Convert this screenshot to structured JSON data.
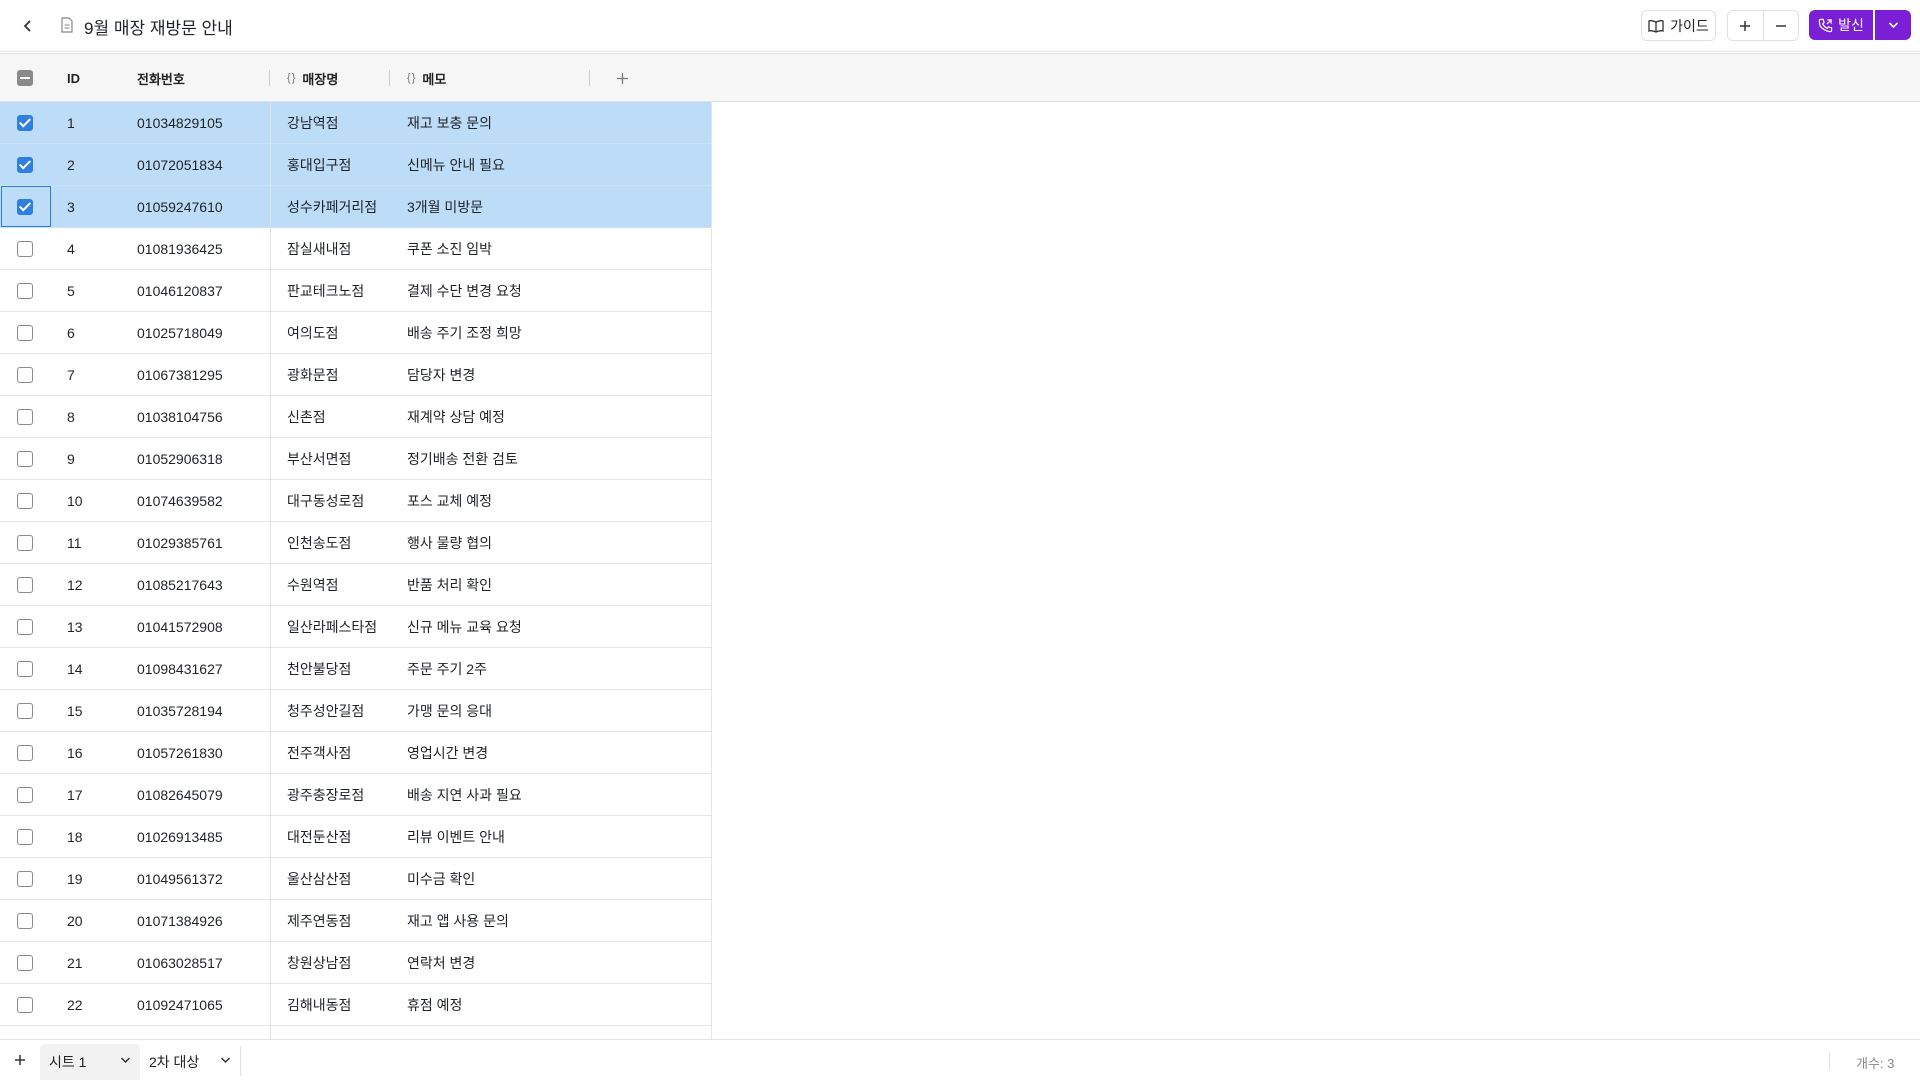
{
  "header": {
    "title": "9월 매장 재방문 안내",
    "guide_label": "가이드",
    "call_label": "발신",
    "accent_color": "#7b1fd6"
  },
  "grid": {
    "columns": [
      {
        "label": "ID"
      },
      {
        "label": "전화번호"
      },
      {
        "label": "매장명",
        "brace": "{ }"
      },
      {
        "label": "메모",
        "brace": "{ }"
      }
    ],
    "selection_color": "#bddcf7",
    "rows": [
      {
        "id": "1",
        "phone": "01034829105",
        "store": "강남역점",
        "memo": "재고 보충 문의",
        "checked": true
      },
      {
        "id": "2",
        "phone": "01072051834",
        "store": "홍대입구점",
        "memo": "신메뉴 안내 필요",
        "checked": true
      },
      {
        "id": "3",
        "phone": "01059247610",
        "store": "성수카페거리점",
        "memo": "3개월 미방문",
        "checked": true,
        "focused": true
      },
      {
        "id": "4",
        "phone": "01081936425",
        "store": "잠실새내점",
        "memo": "쿠폰 소진 임박",
        "checked": false
      },
      {
        "id": "5",
        "phone": "01046120837",
        "store": "판교테크노점",
        "memo": "결제 수단 변경 요청",
        "checked": false
      },
      {
        "id": "6",
        "phone": "01025718049",
        "store": "여의도점",
        "memo": "배송 주기 조정 희망",
        "checked": false
      },
      {
        "id": "7",
        "phone": "01067381295",
        "store": "광화문점",
        "memo": "담당자 변경",
        "checked": false
      },
      {
        "id": "8",
        "phone": "01038104756",
        "store": "신촌점",
        "memo": "재계약 상담 예정",
        "checked": false
      },
      {
        "id": "9",
        "phone": "01052906318",
        "store": "부산서면점",
        "memo": "정기배송 전환 검토",
        "checked": false
      },
      {
        "id": "10",
        "phone": "01074639582",
        "store": "대구동성로점",
        "memo": "포스 교체 예정",
        "checked": false
      },
      {
        "id": "11",
        "phone": "01029385761",
        "store": "인천송도점",
        "memo": "행사 물량 협의",
        "checked": false
      },
      {
        "id": "12",
        "phone": "01085217643",
        "store": "수원역점",
        "memo": "반품 처리 확인",
        "checked": false
      },
      {
        "id": "13",
        "phone": "01041572908",
        "store": "일산라페스타점",
        "memo": "신규 메뉴 교육 요청",
        "checked": false
      },
      {
        "id": "14",
        "phone": "01098431627",
        "store": "천안불당점",
        "memo": "주문 주기 2주",
        "checked": false
      },
      {
        "id": "15",
        "phone": "01035728194",
        "store": "청주성안길점",
        "memo": "가맹 문의 응대",
        "checked": false
      },
      {
        "id": "16",
        "phone": "01057261830",
        "store": "전주객사점",
        "memo": "영업시간 변경",
        "checked": false
      },
      {
        "id": "17",
        "phone": "01082645079",
        "store": "광주충장로점",
        "memo": "배송 지연 사과 필요",
        "checked": false
      },
      {
        "id": "18",
        "phone": "01026913485",
        "store": "대전둔산점",
        "memo": "리뷰 이벤트 안내",
        "checked": false
      },
      {
        "id": "19",
        "phone": "01049561372",
        "store": "울산삼산점",
        "memo": "미수금 확인",
        "checked": false
      },
      {
        "id": "20",
        "phone": "01071384926",
        "store": "제주연동점",
        "memo": "재고 앱 사용 문의",
        "checked": false
      },
      {
        "id": "21",
        "phone": "01063028517",
        "store": "창원상남점",
        "memo": "연락처 변경",
        "checked": false
      },
      {
        "id": "22",
        "phone": "01092471065",
        "store": "김해내동점",
        "memo": "휴점 예정",
        "checked": false
      }
    ]
  },
  "footer": {
    "sheets": [
      "시트 1",
      "2차 대상"
    ],
    "count_label": "개수: 3"
  }
}
